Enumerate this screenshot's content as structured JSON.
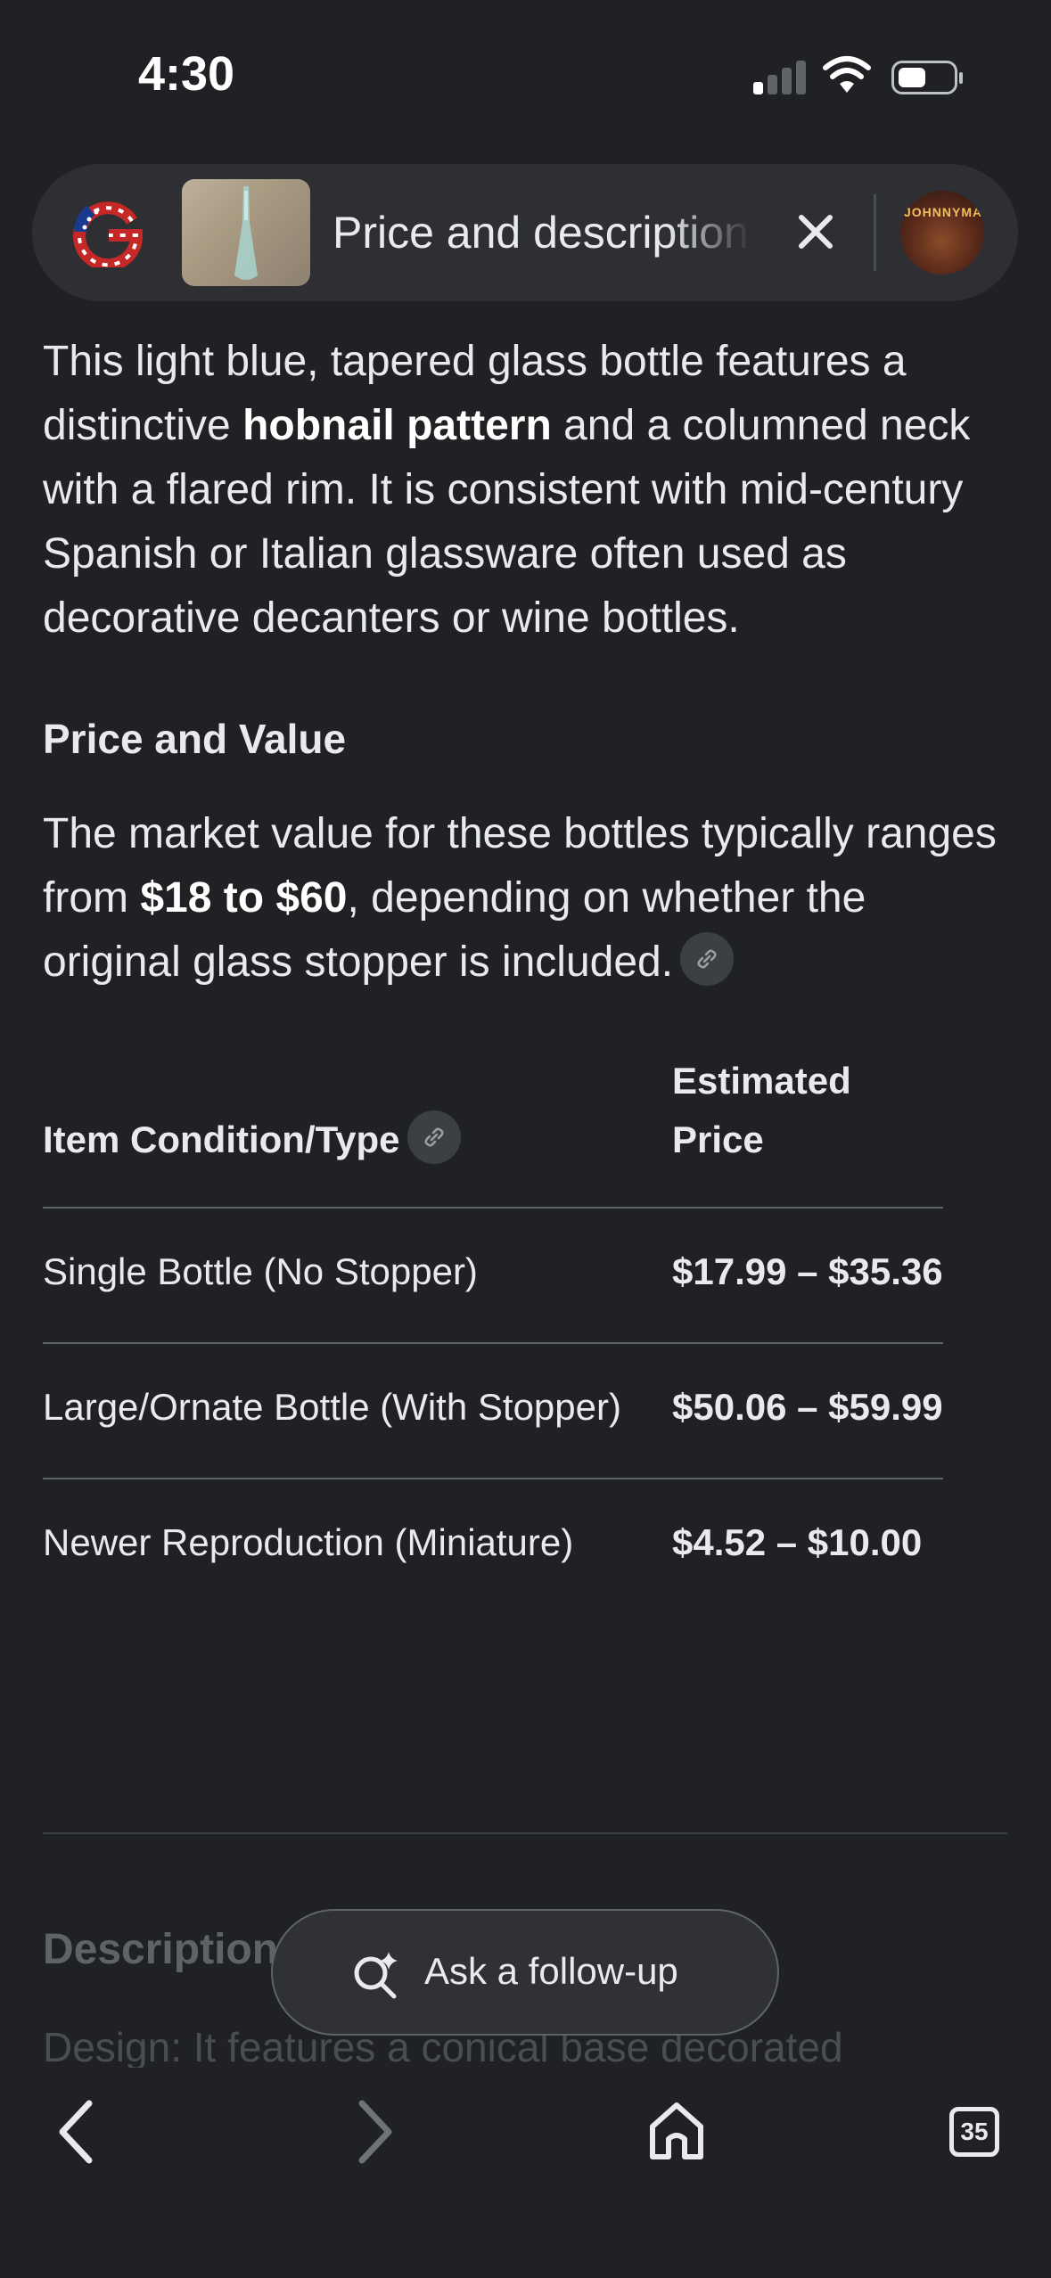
{
  "status_bar": {
    "time": "4:30"
  },
  "search_bar": {
    "title": "Price and description"
  },
  "avatar": {
    "text": "JOHNNYMA"
  },
  "content": {
    "intro_before": "This light blue, tapered glass bottle features a distinctive ",
    "intro_bold": "hobnail pattern",
    "intro_after": " and a columned neck with a flared rim. It is consistent with mid-century Spanish or Italian glassware often used as decorative decanters or wine bottles.",
    "price_heading": "Price and Value",
    "price_before": "The market value for these bottles typically ranges from ",
    "price_bold": "$18 to $60",
    "price_after": ", depending on whether the original glass stopper is included."
  },
  "table": {
    "headers": [
      "Item Condition/Type",
      "Estimated Price"
    ],
    "rows": [
      {
        "type": "Single Bottle (No Stopper)",
        "price": "$17.99 – $35.36"
      },
      {
        "type": "Large/Ornate Bottle (With Stopper)",
        "price": "$50.06 – $59.99"
      },
      {
        "type": "Newer Reproduction (Miniature)",
        "price": "$4.52 – $10.00"
      }
    ]
  },
  "faded": {
    "heading": "Description",
    "bullet": "Design: It features a conical base decorated"
  },
  "followup": {
    "label": "Ask a follow-up"
  },
  "nav": {
    "tabs_count": "35"
  },
  "colors": {
    "background": "#202124",
    "text": "#e8eaed",
    "pill": "#2d2f33"
  }
}
